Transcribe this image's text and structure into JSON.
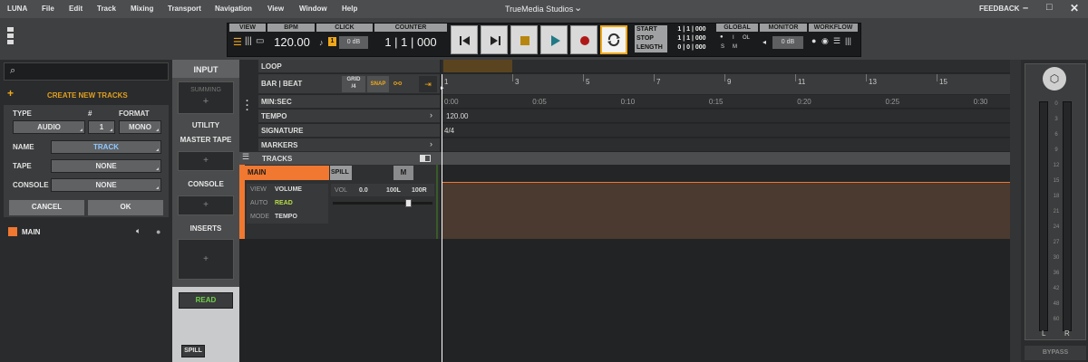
{
  "menu": {
    "app": "LUNA",
    "items": [
      "File",
      "Edit",
      "Track",
      "Mixing",
      "Transport",
      "Navigation",
      "View",
      "Window",
      "Help"
    ],
    "title": "TrueMedia Studios",
    "feedback": "FEEDBACK"
  },
  "toolbar": {
    "view": "VIEW",
    "bpm_label": "BPM",
    "bpm": "120.00",
    "click": "CLICK",
    "click_val": "0 dB",
    "counter_label": "COUNTER",
    "counter": "1 | 1 | 000",
    "start": "START",
    "stop": "STOP",
    "length": "LENGTH",
    "start_val": "1 | 1 | 000",
    "stop_val": "1 | 1 | 000",
    "length_val": "0 | 0 | 000",
    "global": "GLOBAL",
    "g_i": "I",
    "g_ol": "OL",
    "g_s": "S",
    "g_m": "M",
    "monitor": "MONITOR",
    "monitor_val": "0 dB",
    "workflow": "WORKFLOW",
    "click_num": "1"
  },
  "left": {
    "create": "CREATE NEW TRACKS",
    "type": "TYPE",
    "num": "#",
    "format": "FORMAT",
    "type_val": "AUDIO",
    "num_val": "1",
    "format_val": "MONO",
    "name": "NAME",
    "name_val": "TRACK",
    "tape": "TAPE",
    "tape_val": "NONE",
    "console": "CONSOLE",
    "console_val": "NONE",
    "cancel": "CANCEL",
    "ok": "OK",
    "track": "MAIN"
  },
  "mixer": {
    "input": "INPUT",
    "summing": "SUMMING",
    "utility": "UTILITY",
    "master_tape": "MASTER TAPE",
    "console": "CONSOLE",
    "inserts": "INSERTS",
    "read": "READ",
    "spill": "SPILL"
  },
  "timeline": {
    "loop": "LOOP",
    "barbeat": "BAR | BEAT",
    "grid": "GRID",
    "grid_val": "/4",
    "snap": "SNAP",
    "minsec": "MIN:SEC",
    "tempo": "TEMPO",
    "tempo_val": "120.00",
    "signature": "SIGNATURE",
    "sig_val": "4/4",
    "markers": "MARKERS",
    "tracks": "TRACKS",
    "bars": [
      "1",
      "3",
      "5",
      "7",
      "9",
      "11",
      "13",
      "15"
    ],
    "times": [
      "0:00",
      "0:05",
      "0:10",
      "0:15",
      "0:20",
      "0:25",
      "0:30"
    ]
  },
  "track": {
    "name": "MAIN",
    "spill": "SPILL",
    "m": "M",
    "view": "VIEW",
    "view_val": "VOLUME",
    "auto": "AUTO",
    "auto_val": "READ",
    "mode": "MODE",
    "mode_val": "TEMPO",
    "vol": "VOL",
    "vol_val": "0.0",
    "l": "100L",
    "r": "100R"
  },
  "meter": {
    "scale": [
      "0",
      "3",
      "6",
      "9",
      "12",
      "15",
      "18",
      "21",
      "24",
      "27",
      "30",
      "36",
      "42",
      "48",
      "60"
    ],
    "l": "L",
    "r": "R",
    "bypass": "BYPASS"
  }
}
